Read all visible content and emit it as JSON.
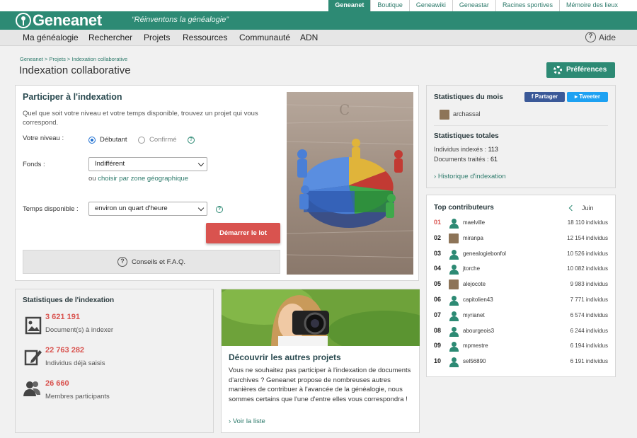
{
  "toplinks": [
    {
      "label": "Geneanet",
      "active": true
    },
    {
      "label": "Boutique"
    },
    {
      "label": "Geneawiki"
    },
    {
      "label": "Geneastar"
    },
    {
      "label": "Racines sportives"
    },
    {
      "label": "Mémoire des lieux"
    }
  ],
  "brand": {
    "name": "Geneanet",
    "slogan": "“Réinventons la généalogie”"
  },
  "nav": {
    "items": [
      "Ma généalogie",
      "Rechercher",
      "Projets",
      "Ressources",
      "Communauté",
      "ADN"
    ],
    "help": "Aide"
  },
  "breadcrumb": "Geneanet > Projets > Indexation collaborative",
  "page_title": "Indexation collaborative",
  "preferences_label": "Préférences",
  "participate": {
    "title": "Participer à l'indexation",
    "intro": "Quel que soit votre niveau et votre temps disponible, trouvez un projet qui vous correspond.",
    "level_label": "Votre niveau :",
    "level_options": [
      "Débutant",
      "Confirmé"
    ],
    "level_selected": "Débutant",
    "fonds_label": "Fonds :",
    "fonds_value": "Indifférent",
    "geo_prefix": "ou",
    "geo_link": "choisir par zone géographique",
    "time_label": "Temps disponible :",
    "time_value": "environ un quart d'heure",
    "start_button": "Démarrer le lot",
    "faq": "Conseils et F.A.Q."
  },
  "month_stats": {
    "title": "Statistiques du mois",
    "share_facebook": "Partager",
    "share_twitter": "Tweeter",
    "user": "archassal"
  },
  "total_stats": {
    "title": "Statistiques totales",
    "indexed_label": "Individus indexés :",
    "indexed_value": "113",
    "docs_label": "Documents traités :",
    "docs_value": "61",
    "history_link": "Historique d'indexation"
  },
  "top": {
    "title": "Top contributeurs",
    "month": "Juin",
    "rows": [
      {
        "rank": "01",
        "name": "maelville",
        "value": "18 110 individus",
        "avatar": "person"
      },
      {
        "rank": "02",
        "name": "miranpa",
        "value": "12 154 individus",
        "avatar": "photo"
      },
      {
        "rank": "03",
        "name": "genealogiebonfol",
        "value": "10 526 individus",
        "avatar": "person"
      },
      {
        "rank": "04",
        "name": "jtorche",
        "value": "10 082 individus",
        "avatar": "person"
      },
      {
        "rank": "05",
        "name": "alejocote",
        "value": "9 983 individus",
        "avatar": "photo"
      },
      {
        "rank": "06",
        "name": "capitolien43",
        "value": "7 771 individus",
        "avatar": "person"
      },
      {
        "rank": "07",
        "name": "myrianet",
        "value": "6 574 individus",
        "avatar": "person"
      },
      {
        "rank": "08",
        "name": "abourgeois3",
        "value": "6 244 individus",
        "avatar": "person"
      },
      {
        "rank": "09",
        "name": "mpmestre",
        "value": "6 194 individus",
        "avatar": "person"
      },
      {
        "rank": "10",
        "name": "sel56890",
        "value": "6 191 individus",
        "avatar": "person"
      }
    ]
  },
  "index_stats": {
    "title": "Statistiques de l'indexation",
    "items": [
      {
        "value": "3 621 191",
        "label": "Document(s) à indexer",
        "icon": "image-document-icon"
      },
      {
        "value": "22 763 282",
        "label": "Individus déjà saisis",
        "icon": "edit-document-icon"
      },
      {
        "value": "26 660",
        "label": "Membres participants",
        "icon": "members-icon"
      }
    ]
  },
  "discover": {
    "title": "Découvrir les autres projets",
    "text": "Vous ne souhaitez pas participer à l'indexation de documents d'archives ? Geneanet propose de nombreuses autres manières de contribuer à l'avancée de la généalogie, nous sommes certains que l'une d'entre elles vous correspondra !",
    "link": "Voir la liste"
  },
  "colors": {
    "brand": "#2d8a74",
    "accent_red": "#d9534f",
    "facebook": "#3b5998",
    "twitter": "#1da1f2"
  }
}
